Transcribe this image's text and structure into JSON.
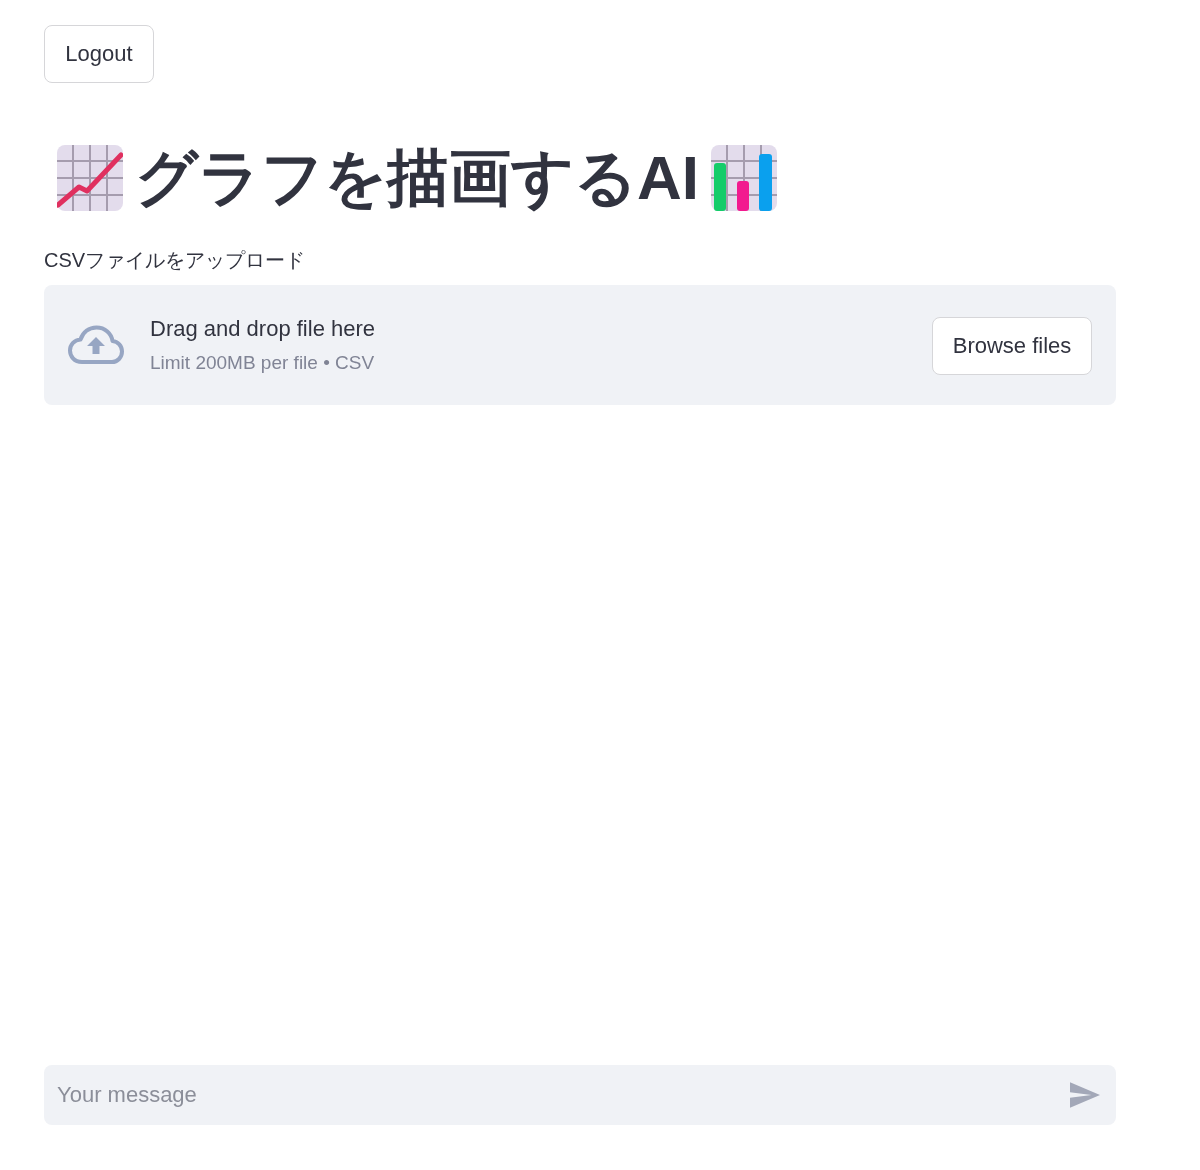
{
  "logout_button": {
    "label": "Logout"
  },
  "title": {
    "text": "グラフを描画するAI"
  },
  "file_uploader": {
    "label": "CSVファイルをアップロード",
    "instruction": "Drag and drop file here",
    "limit_note": "Limit 200MB per file • CSV",
    "button": "Browse files"
  },
  "chat_input": {
    "placeholder": "Your message"
  }
}
